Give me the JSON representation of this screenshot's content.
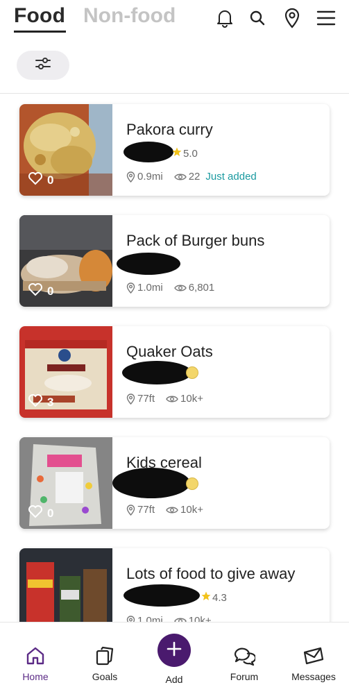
{
  "header": {
    "tab_food": "Food",
    "tab_nonfood": "Non-food",
    "icons": [
      "bell-icon",
      "search-icon",
      "location-pin-icon",
      "menu-icon"
    ]
  },
  "filter": {
    "icon": "sliders-icon"
  },
  "listings": [
    {
      "title": "Pakora curry",
      "rating": "5.0",
      "distance": "0.9mi",
      "views": "22",
      "status": "Just added",
      "likes": "0"
    },
    {
      "title": "Pack of Burger buns",
      "rating": "",
      "distance": "1.0mi",
      "views": "6,801",
      "status": "",
      "likes": "0"
    },
    {
      "title": "Quaker Oats",
      "rating": "",
      "distance": "77ft",
      "views": "10k+",
      "status": "",
      "likes": "3"
    },
    {
      "title": "Kids cereal",
      "rating": "",
      "distance": "77ft",
      "views": "10k+",
      "status": "",
      "likes": "0"
    },
    {
      "title": "Lots of food to give away",
      "rating": "4.3",
      "distance": "1.0mi",
      "views": "10k+",
      "status": "",
      "likes": ""
    }
  ],
  "colors": {
    "accent_purple": "#4a1a6e",
    "home_active": "#5b2a86",
    "just_added": "#1a9aa0",
    "star": "#f2c21b"
  },
  "bottom_nav": {
    "home": "Home",
    "goals": "Goals",
    "add": "Add",
    "forum": "Forum",
    "messages": "Messages"
  }
}
